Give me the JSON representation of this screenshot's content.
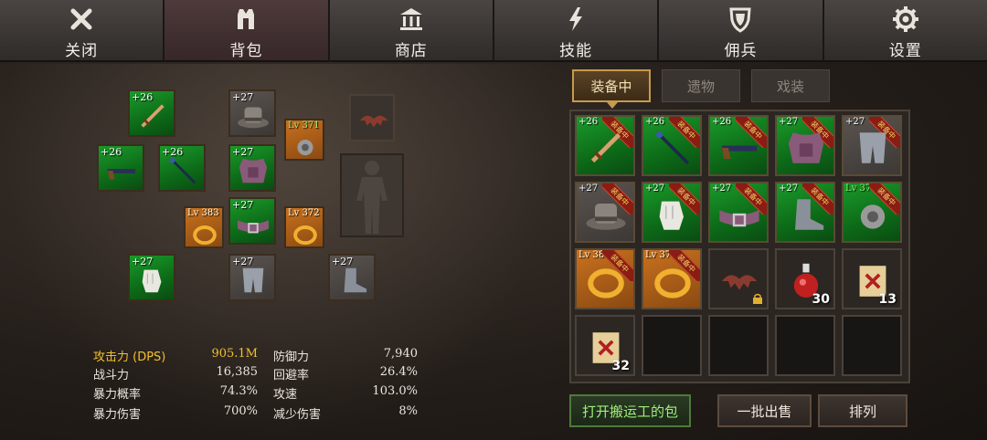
{
  "nav": [
    {
      "label": "关闭",
      "icon": "close-icon"
    },
    {
      "label": "背包",
      "icon": "bag-icon"
    },
    {
      "label": "商店",
      "icon": "shop-icon"
    },
    {
      "label": "技能",
      "icon": "skill-icon"
    },
    {
      "label": "佣兵",
      "icon": "mercenary-icon"
    },
    {
      "label": "设置",
      "icon": "settings-icon"
    }
  ],
  "active_nav": "背包",
  "equipped": {
    "sword": "+26",
    "hat": "+27",
    "gun": "+26",
    "staff": "+26",
    "armor": "+27",
    "amulet": "Lv 371",
    "ring_left": "Lv 383",
    "belt": "+27",
    "ring_right": "Lv 372",
    "gloves": "+27",
    "pants": "+27",
    "boots": "+27"
  },
  "stats": [
    {
      "label": "攻击力 (DPS)",
      "value": "905.1M"
    },
    {
      "label": "防御力",
      "value": "7,940"
    },
    {
      "label": "战斗力",
      "value": "16,385"
    },
    {
      "label": "回避率",
      "value": "26.4%"
    },
    {
      "label": "暴力概率",
      "value": "74.3%"
    },
    {
      "label": "攻速",
      "value": "103.0%"
    },
    {
      "label": "暴力伤害",
      "value": "700%"
    },
    {
      "label": "减少伤害",
      "value": "8%"
    }
  ],
  "subtabs": [
    "装备中",
    "遗物",
    "戏装"
  ],
  "equipped_badge": "装备中",
  "inventory": [
    {
      "tag": "+26",
      "icon": "sword-icon"
    },
    {
      "tag": "+26",
      "icon": "staff-icon"
    },
    {
      "tag": "+26",
      "icon": "gun-icon"
    },
    {
      "tag": "+27",
      "icon": "chest-armor-icon"
    },
    {
      "tag": "+27",
      "icon": "leg-armor-icon"
    },
    {
      "tag": "+27",
      "icon": "hat-icon"
    },
    {
      "tag": "+27",
      "icon": "gloves-icon"
    },
    {
      "tag": "+27",
      "icon": "belt-icon"
    },
    {
      "tag": "+27",
      "icon": "boots-icon"
    },
    {
      "tag": "Lv 371",
      "icon": "amulet-icon"
    },
    {
      "tag": "Lv 383",
      "icon": "ring-icon"
    },
    {
      "tag": "Lv 372",
      "icon": "ring-icon"
    },
    {
      "tag": "",
      "icon": "bat-wing-icon"
    },
    {
      "tag": "",
      "icon": "potion-icon",
      "count": "30"
    },
    {
      "tag": "",
      "icon": "scroll-icon",
      "count": "13"
    },
    {
      "tag": "",
      "icon": "scroll-icon",
      "count": "32"
    }
  ],
  "buttons": {
    "open_porter": "打开搬运工的包",
    "bulk_sell": "一批出售",
    "sort": "排列"
  },
  "colors": {
    "rarity_green": "#0d6a18",
    "rarity_orange": "#c8711e",
    "highlight": "#f2c12e",
    "badge_red": "#8a1c14"
  }
}
